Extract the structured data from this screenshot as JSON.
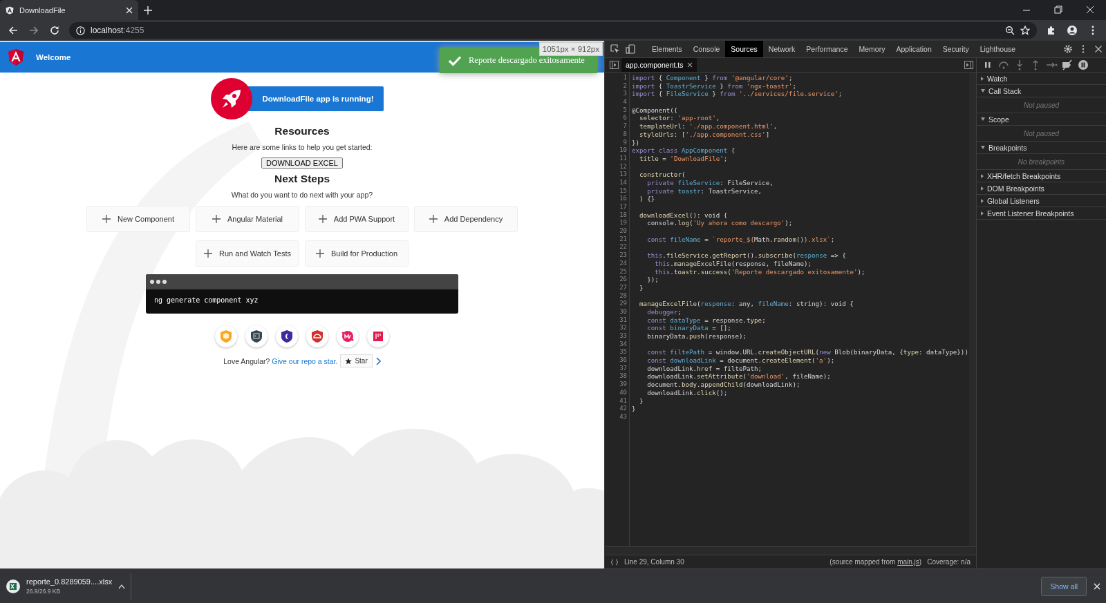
{
  "browser": {
    "tab": {
      "title": "DownloadFile",
      "selected": true
    },
    "address": {
      "host": "localhost",
      "port": ":4255"
    }
  },
  "page": {
    "header_title": "Welcome",
    "size_overlay": "1051px × 912px",
    "toast": "Reporte descargado exitosamente",
    "banner": "DownloadFile app is running!",
    "resources_title": "Resources",
    "resources_text": "Here are some links to help you get started:",
    "download_button": "DOWNLOAD EXCEL",
    "next_title": "Next Steps",
    "next_text": "What do you want to do next with your app?",
    "actions": [
      {
        "label": "New Component"
      },
      {
        "label": "Angular Material"
      },
      {
        "label": "Add PWA Support"
      },
      {
        "label": "Add Dependency"
      },
      {
        "label": "Run and Watch Tests"
      },
      {
        "label": "Build for Production"
      }
    ],
    "terminal": "ng generate component xyz",
    "love_text": "Love Angular? ",
    "repo_link": "Give our repo a star.",
    "star_button": "Star"
  },
  "devtools": {
    "tabs": [
      {
        "label": "Elements",
        "selected": false
      },
      {
        "label": "Console",
        "selected": false
      },
      {
        "label": "Sources",
        "selected": true
      },
      {
        "label": "Network",
        "selected": false
      },
      {
        "label": "Performance",
        "selected": false
      },
      {
        "label": "Memory",
        "selected": false
      },
      {
        "label": "Application",
        "selected": false
      },
      {
        "label": "Security",
        "selected": false
      },
      {
        "label": "Lighthouse",
        "selected": false
      }
    ],
    "file_tab": {
      "label": "app.component.ts",
      "selected": true
    },
    "code": [
      {
        "number": "1",
        "tokens": [
          {
            "kind": "keyword",
            "text": "import"
          },
          {
            "kind": "plain",
            "text": " { "
          },
          {
            "kind": "name",
            "text": "Component"
          },
          {
            "kind": "plain",
            "text": " } "
          },
          {
            "kind": "keyword",
            "text": "from "
          },
          {
            "kind": "string",
            "text": "'@angular/core'"
          },
          {
            "kind": "plain",
            "text": ";"
          }
        ]
      },
      {
        "number": "2",
        "tokens": [
          {
            "kind": "keyword",
            "text": "import"
          },
          {
            "kind": "plain",
            "text": " { "
          },
          {
            "kind": "name",
            "text": "ToastrService"
          },
          {
            "kind": "plain",
            "text": " } "
          },
          {
            "kind": "keyword",
            "text": "from "
          },
          {
            "kind": "string",
            "text": "'ngx-toastr'"
          },
          {
            "kind": "plain",
            "text": ";"
          }
        ]
      },
      {
        "number": "3",
        "tokens": [
          {
            "kind": "keyword",
            "text": "import"
          },
          {
            "kind": "plain",
            "text": " { "
          },
          {
            "kind": "name",
            "text": "FileService"
          },
          {
            "kind": "plain",
            "text": " } "
          },
          {
            "kind": "keyword",
            "text": "from "
          },
          {
            "kind": "string",
            "text": "'../services/file.service'"
          },
          {
            "kind": "plain",
            "text": ";"
          }
        ]
      },
      {
        "number": "4"
      },
      {
        "number": "5",
        "tokens": [
          {
            "kind": "plain",
            "text": "@Component({"
          }
        ]
      },
      {
        "number": "6",
        "tokens": [
          {
            "kind": "member",
            "text": "  selector"
          },
          {
            "kind": "plain",
            "text": ": "
          },
          {
            "kind": "string",
            "text": "'app-root'"
          },
          {
            "kind": "plain",
            "text": ","
          }
        ]
      },
      {
        "number": "7",
        "tokens": [
          {
            "kind": "member",
            "text": "  templateUrl"
          },
          {
            "kind": "plain",
            "text": ": "
          },
          {
            "kind": "string",
            "text": "'./app.component.html'"
          },
          {
            "kind": "plain",
            "text": ","
          }
        ]
      },
      {
        "number": "8",
        "tokens": [
          {
            "kind": "member",
            "text": "  styleUrls"
          },
          {
            "kind": "plain",
            "text": ": ["
          },
          {
            "kind": "string",
            "text": "'./app.component.css'"
          },
          {
            "kind": "plain",
            "text": "]"
          }
        ]
      },
      {
        "number": "9",
        "tokens": [
          {
            "kind": "plain",
            "text": "})"
          }
        ]
      },
      {
        "number": "10",
        "tokens": [
          {
            "kind": "keyword",
            "text": "export class "
          },
          {
            "kind": "name",
            "text": "AppComponent"
          },
          {
            "kind": "plain",
            "text": " {"
          }
        ]
      },
      {
        "number": "11",
        "tokens": [
          {
            "kind": "member",
            "text": "  title"
          },
          {
            "kind": "plain",
            "text": " = "
          },
          {
            "kind": "string",
            "text": "'DownloadFile'"
          },
          {
            "kind": "plain",
            "text": ";"
          }
        ]
      },
      {
        "number": "12"
      },
      {
        "number": "13",
        "tokens": [
          {
            "kind": "member",
            "text": "  constructor"
          },
          {
            "kind": "plain",
            "text": "("
          }
        ]
      },
      {
        "number": "14",
        "tokens": [
          {
            "kind": "keyword",
            "text": "    private "
          },
          {
            "kind": "name",
            "text": "fileService"
          },
          {
            "kind": "plain",
            "text": ": FileService,"
          }
        ]
      },
      {
        "number": "15",
        "tokens": [
          {
            "kind": "keyword",
            "text": "    private "
          },
          {
            "kind": "name",
            "text": "toastr"
          },
          {
            "kind": "plain",
            "text": ": ToastrService,"
          }
        ]
      },
      {
        "number": "16",
        "tokens": [
          {
            "kind": "plain",
            "text": "  ) {}"
          }
        ]
      },
      {
        "number": "17"
      },
      {
        "number": "18",
        "tokens": [
          {
            "kind": "member",
            "text": "  downloadExcel"
          },
          {
            "kind": "plain",
            "text": "(): void {"
          }
        ]
      },
      {
        "number": "19",
        "tokens": [
          {
            "kind": "plain",
            "text": "    console."
          },
          {
            "kind": "member",
            "text": "log"
          },
          {
            "kind": "plain",
            "text": "("
          },
          {
            "kind": "string",
            "text": "'Uy ahora como descargo'"
          },
          {
            "kind": "plain",
            "text": ");"
          }
        ]
      },
      {
        "number": "20"
      },
      {
        "number": "21",
        "tokens": [
          {
            "kind": "keyword",
            "text": "    const "
          },
          {
            "kind": "name",
            "text": "fileName"
          },
          {
            "kind": "plain",
            "text": " = "
          },
          {
            "kind": "string",
            "text": "`reporte_${"
          },
          {
            "kind": "plain",
            "text": "Math."
          },
          {
            "kind": "member",
            "text": "random"
          },
          {
            "kind": "plain",
            "text": "()"
          },
          {
            "kind": "string",
            "text": "}.xlsx`"
          },
          {
            "kind": "plain",
            "text": ";"
          }
        ]
      },
      {
        "number": "22"
      },
      {
        "number": "23",
        "tokens": [
          {
            "kind": "keyword",
            "text": "    this"
          },
          {
            "kind": "plain",
            "text": "."
          },
          {
            "kind": "member",
            "text": "fileService"
          },
          {
            "kind": "plain",
            "text": "."
          },
          {
            "kind": "member",
            "text": "getReport"
          },
          {
            "kind": "plain",
            "text": "()."
          },
          {
            "kind": "member",
            "text": "subscribe"
          },
          {
            "kind": "plain",
            "text": "("
          },
          {
            "kind": "name",
            "text": "response"
          },
          {
            "kind": "plain",
            "text": " => {"
          }
        ]
      },
      {
        "number": "24",
        "tokens": [
          {
            "kind": "keyword",
            "text": "      this"
          },
          {
            "kind": "plain",
            "text": "."
          },
          {
            "kind": "member",
            "text": "manageExcelFile"
          },
          {
            "kind": "plain",
            "text": "(response, fileName);"
          }
        ]
      },
      {
        "number": "25",
        "tokens": [
          {
            "kind": "keyword",
            "text": "      this"
          },
          {
            "kind": "plain",
            "text": "."
          },
          {
            "kind": "member",
            "text": "toastr"
          },
          {
            "kind": "plain",
            "text": "."
          },
          {
            "kind": "member",
            "text": "success"
          },
          {
            "kind": "plain",
            "text": "("
          },
          {
            "kind": "string",
            "text": "'Reporte descargado exitosamente'"
          },
          {
            "kind": "plain",
            "text": ");"
          }
        ]
      },
      {
        "number": "26",
        "tokens": [
          {
            "kind": "plain",
            "text": "    });"
          }
        ]
      },
      {
        "number": "27",
        "tokens": [
          {
            "kind": "plain",
            "text": "  }"
          }
        ]
      },
      {
        "number": "28"
      },
      {
        "number": "29",
        "tokens": [
          {
            "kind": "member",
            "text": "  manageExcelFile"
          },
          {
            "kind": "plain",
            "text": "("
          },
          {
            "kind": "name",
            "text": "response"
          },
          {
            "kind": "plain",
            "text": ": any, "
          },
          {
            "kind": "name",
            "text": "fileName"
          },
          {
            "kind": "plain",
            "text": ": string): void {"
          }
        ]
      },
      {
        "number": "30",
        "tokens": [
          {
            "kind": "keyword",
            "text": "    debugger"
          },
          {
            "kind": "plain",
            "text": ";"
          }
        ]
      },
      {
        "number": "31",
        "tokens": [
          {
            "kind": "keyword",
            "text": "    const "
          },
          {
            "kind": "name",
            "text": "dataType"
          },
          {
            "kind": "plain",
            "text": " = response."
          },
          {
            "kind": "member",
            "text": "type"
          },
          {
            "kind": "plain",
            "text": ";"
          }
        ]
      },
      {
        "number": "32",
        "tokens": [
          {
            "kind": "keyword",
            "text": "    const "
          },
          {
            "kind": "name",
            "text": "binaryData"
          },
          {
            "kind": "plain",
            "text": " = [];"
          }
        ]
      },
      {
        "number": "33",
        "tokens": [
          {
            "kind": "plain",
            "text": "    binaryData."
          },
          {
            "kind": "member",
            "text": "push"
          },
          {
            "kind": "plain",
            "text": "(response);"
          }
        ]
      },
      {
        "number": "34"
      },
      {
        "number": "35",
        "tokens": [
          {
            "kind": "keyword",
            "text": "    const "
          },
          {
            "kind": "name",
            "text": "filtePath"
          },
          {
            "kind": "plain",
            "text": " = window."
          },
          {
            "kind": "member",
            "text": "URL"
          },
          {
            "kind": "plain",
            "text": "."
          },
          {
            "kind": "member",
            "text": "createObjectURL"
          },
          {
            "kind": "plain",
            "text": "("
          },
          {
            "kind": "keyword",
            "text": "new "
          },
          {
            "kind": "plain",
            "text": "Blob(binaryData, {"
          },
          {
            "kind": "member",
            "text": "type"
          },
          {
            "kind": "plain",
            "text": ": dataType}))"
          }
        ]
      },
      {
        "number": "36",
        "tokens": [
          {
            "kind": "keyword",
            "text": "    const "
          },
          {
            "kind": "name",
            "text": "downloadLink"
          },
          {
            "kind": "plain",
            "text": " = document."
          },
          {
            "kind": "member",
            "text": "createElement"
          },
          {
            "kind": "plain",
            "text": "("
          },
          {
            "kind": "string",
            "text": "'a'"
          },
          {
            "kind": "plain",
            "text": ");"
          }
        ]
      },
      {
        "number": "37",
        "tokens": [
          {
            "kind": "plain",
            "text": "    downloadLink."
          },
          {
            "kind": "member",
            "text": "href"
          },
          {
            "kind": "plain",
            "text": " = filtePath;"
          }
        ]
      },
      {
        "number": "38",
        "tokens": [
          {
            "kind": "plain",
            "text": "    downloadLink."
          },
          {
            "kind": "member",
            "text": "setAttribute"
          },
          {
            "kind": "plain",
            "text": "("
          },
          {
            "kind": "string",
            "text": "'download'"
          },
          {
            "kind": "plain",
            "text": ", fileName);"
          }
        ]
      },
      {
        "number": "39",
        "tokens": [
          {
            "kind": "plain",
            "text": "    document."
          },
          {
            "kind": "member",
            "text": "body"
          },
          {
            "kind": "plain",
            "text": "."
          },
          {
            "kind": "member",
            "text": "appendChild"
          },
          {
            "kind": "plain",
            "text": "(downloadLink);"
          }
        ]
      },
      {
        "number": "40",
        "tokens": [
          {
            "kind": "plain",
            "text": "    downloadLink."
          },
          {
            "kind": "member",
            "text": "click"
          },
          {
            "kind": "plain",
            "text": "();"
          }
        ]
      },
      {
        "number": "41",
        "tokens": [
          {
            "kind": "plain",
            "text": "  }"
          }
        ]
      },
      {
        "number": "42",
        "tokens": [
          {
            "kind": "plain",
            "text": "}"
          }
        ]
      },
      {
        "number": "43"
      }
    ],
    "status": {
      "position": "Line 29, Column 30",
      "source_prefix": "(source mapped from ",
      "source_link": "main.js",
      "source_suffix": ")",
      "coverage": "Coverage: n/a"
    },
    "sections": [
      {
        "title": "Watch",
        "expanded": false
      },
      {
        "title": "Call Stack",
        "expanded": true,
        "message": "Not paused"
      },
      {
        "title": "Scope",
        "expanded": true,
        "message": "Not paused"
      },
      {
        "title": "Breakpoints",
        "expanded": true,
        "message": "No breakpoints"
      },
      {
        "title": "XHR/fetch Breakpoints",
        "expanded": false
      },
      {
        "title": "DOM Breakpoints",
        "expanded": false
      },
      {
        "title": "Global Listeners",
        "expanded": false
      },
      {
        "title": "Event Listener Breakpoints",
        "expanded": false
      }
    ]
  },
  "download": {
    "file_name": "reporte_0.8289059....xlsx",
    "progress": "26.9/26.9 KB",
    "show_all": "Show all"
  }
}
